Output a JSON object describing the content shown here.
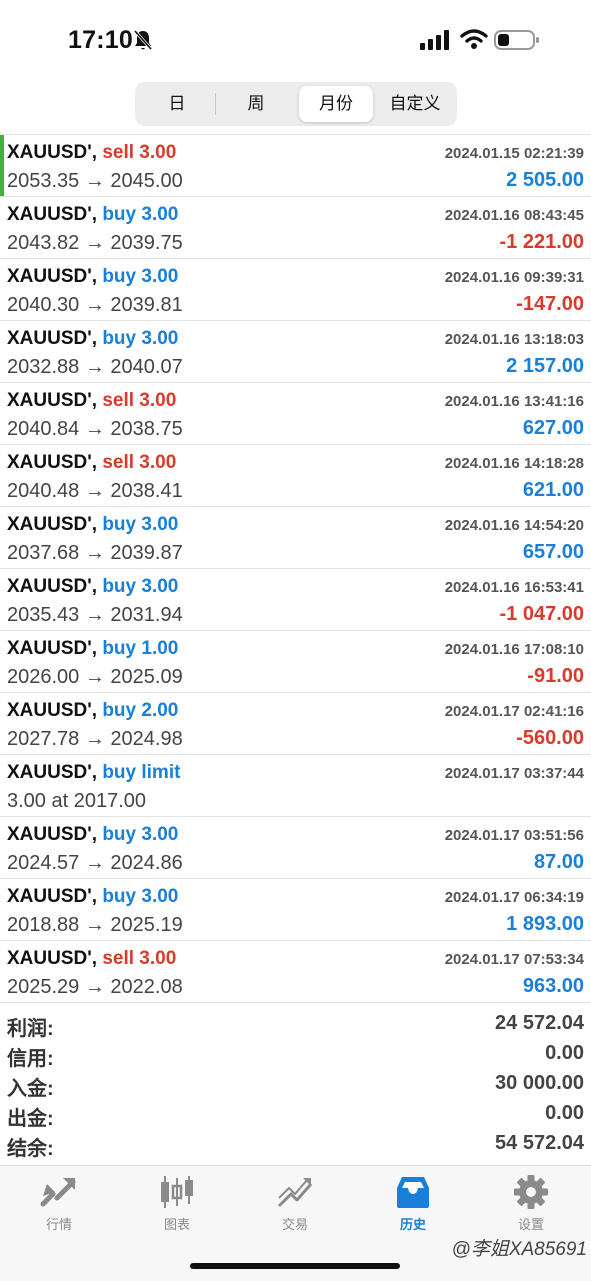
{
  "status": {
    "time": "17:10"
  },
  "segments": [
    "日",
    "周",
    "月份",
    "自定义"
  ],
  "active_segment": 2,
  "trades": [
    {
      "symbol": "XAUUSD'",
      "sep": ",",
      "side": "sell",
      "size": "3.00",
      "datetime": "2024.01.15 02:21:39",
      "open": "2053.35",
      "close": "2045.00",
      "profit": "2 505.00",
      "sign": "pos"
    },
    {
      "symbol": "XAUUSD'",
      "sep": ",",
      "side": "buy",
      "size": "3.00",
      "datetime": "2024.01.16 08:43:45",
      "open": "2043.82",
      "close": "2039.75",
      "profit": "-1 221.00",
      "sign": "neg"
    },
    {
      "symbol": "XAUUSD'",
      "sep": ",",
      "side": "buy",
      "size": "3.00",
      "datetime": "2024.01.16 09:39:31",
      "open": "2040.30",
      "close": "2039.81",
      "profit": "-147.00",
      "sign": "neg"
    },
    {
      "symbol": "XAUUSD'",
      "sep": ",",
      "side": "buy",
      "size": "3.00",
      "datetime": "2024.01.16 13:18:03",
      "open": "2032.88",
      "close": "2040.07",
      "profit": "2 157.00",
      "sign": "pos"
    },
    {
      "symbol": "XAUUSD'",
      "sep": ",",
      "side": "sell",
      "size": "3.00",
      "datetime": "2024.01.16 13:41:16",
      "open": "2040.84",
      "close": "2038.75",
      "profit": "627.00",
      "sign": "pos"
    },
    {
      "symbol": "XAUUSD'",
      "sep": ",",
      "side": "sell",
      "size": "3.00",
      "datetime": "2024.01.16 14:18:28",
      "open": "2040.48",
      "close": "2038.41",
      "profit": "621.00",
      "sign": "pos"
    },
    {
      "symbol": "XAUUSD'",
      "sep": ",",
      "side": "buy",
      "size": "3.00",
      "datetime": "2024.01.16 14:54:20",
      "open": "2037.68",
      "close": "2039.87",
      "profit": "657.00",
      "sign": "pos"
    },
    {
      "symbol": "XAUUSD'",
      "sep": ",",
      "side": "buy",
      "size": "3.00",
      "datetime": "2024.01.16 16:53:41",
      "open": "2035.43",
      "close": "2031.94",
      "profit": "-1 047.00",
      "sign": "neg"
    },
    {
      "symbol": "XAUUSD'",
      "sep": ",",
      "side": "buy",
      "size": "1.00",
      "datetime": "2024.01.16 17:08:10",
      "open": "2026.00",
      "close": "2025.09",
      "profit": "-91.00",
      "sign": "neg"
    },
    {
      "symbol": "XAUUSD'",
      "sep": ",",
      "side": "buy",
      "size": "2.00",
      "datetime": "2024.01.17 02:41:16",
      "open": "2027.78",
      "close": "2024.98",
      "profit": "-560.00",
      "sign": "neg"
    },
    {
      "symbol": "XAUUSD'",
      "sep": ",",
      "side": "buy limit",
      "size": "",
      "datetime": "2024.01.17 03:37:44",
      "line2": "3.00 at 2017.00",
      "profit": "",
      "sign": "pos"
    },
    {
      "symbol": "XAUUSD'",
      "sep": ",",
      "side": "buy",
      "size": "3.00",
      "datetime": "2024.01.17 03:51:56",
      "open": "2024.57",
      "close": "2024.86",
      "profit": "87.00",
      "sign": "pos"
    },
    {
      "symbol": "XAUUSD'",
      "sep": ",",
      "side": "buy",
      "size": "3.00",
      "datetime": "2024.01.17 06:34:19",
      "open": "2018.88",
      "close": "2025.19",
      "profit": "1 893.00",
      "sign": "pos"
    },
    {
      "symbol": "XAUUSD'",
      "sep": ",",
      "side": "sell",
      "size": "3.00",
      "datetime": "2024.01.17 07:53:34",
      "open": "2025.29",
      "close": "2022.08",
      "profit": "963.00",
      "sign": "pos"
    }
  ],
  "arrow": "→",
  "summary": [
    {
      "label": "利润:",
      "value": "24 572.04"
    },
    {
      "label": "信用:",
      "value": "0.00"
    },
    {
      "label": "入金:",
      "value": "30 000.00"
    },
    {
      "label": "出金:",
      "value": "0.00"
    },
    {
      "label": "结余:",
      "value": "54 572.04"
    }
  ],
  "tabs": [
    {
      "label": "行情",
      "icon": "quotes-icon"
    },
    {
      "label": "图表",
      "icon": "chart-icon"
    },
    {
      "label": "交易",
      "icon": "trade-icon"
    },
    {
      "label": "历史",
      "icon": "history-icon"
    },
    {
      "label": "设置",
      "icon": "settings-icon"
    }
  ],
  "active_tab": 3,
  "watermark": "@李姐XA85691",
  "colors": {
    "buy": "#1a7fd8",
    "sell": "#d83b2a",
    "profit": "#1a7fd8",
    "loss": "#d83b2a",
    "marker": "#3db33d"
  }
}
